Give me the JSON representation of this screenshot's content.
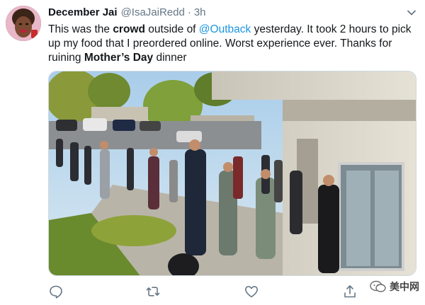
{
  "tweet": {
    "display_name": "December Jai",
    "handle": "@IsaJaiRedd",
    "separator": "·",
    "time": "3h",
    "text_parts": [
      {
        "t": "This was the ",
        "s": "plain"
      },
      {
        "t": "crowd",
        "s": "bold"
      },
      {
        "t": " outside of ",
        "s": "plain"
      },
      {
        "t": "@Outback",
        "s": "mention"
      },
      {
        "t": " yesterday. It took 2 hours to pick up my food that I preordered online. Worst experience ever. Thanks for ruining ",
        "s": "plain"
      },
      {
        "t": "Mother’s Day",
        "s": "bold"
      },
      {
        "t": " dinner",
        "s": "plain"
      }
    ]
  },
  "actions": [
    {
      "name": "reply-icon"
    },
    {
      "name": "retweet-icon"
    },
    {
      "name": "like-icon"
    },
    {
      "name": "share-icon"
    }
  ],
  "watermark": {
    "text": "美中网",
    "icon": "wechat-icon"
  },
  "colors": {
    "link": "#1b95e0",
    "muted": "#657786",
    "text": "#14171a"
  }
}
